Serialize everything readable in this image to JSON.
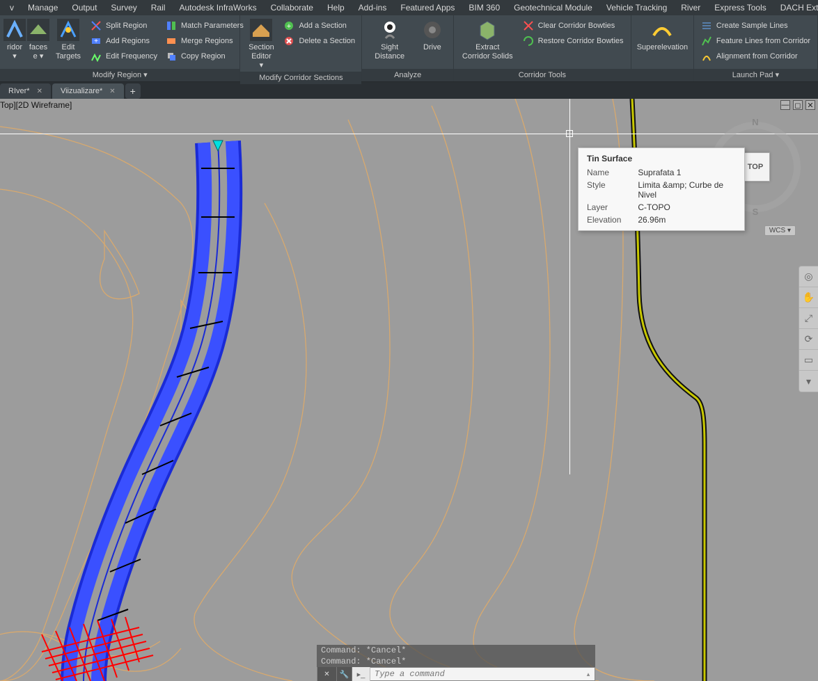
{
  "menubar": {
    "items": [
      "v",
      "Manage",
      "Output",
      "Survey",
      "Rail",
      "Autodesk InfraWorks",
      "Collaborate",
      "Help",
      "Add-ins",
      "Featured Apps",
      "BIM 360",
      "Geotechnical Module",
      "Vehicle Tracking",
      "River",
      "Express Tools",
      "DACH Extension"
    ]
  },
  "ribbon": {
    "panels": [
      {
        "title": "Modify Region ▾",
        "big": [
          {
            "label1": "ridor",
            "label2": "▾",
            "icon": "corridor-icon"
          },
          {
            "label1": "faces",
            "label2": "e ▾",
            "icon": "surface-icon"
          },
          {
            "label1": "Edit",
            "label2": "Targets",
            "icon": "edit-targets-icon"
          }
        ],
        "small": [
          {
            "label": "Split Region",
            "icon": "split-region-icon"
          },
          {
            "label": "Add Regions",
            "icon": "add-regions-icon"
          },
          {
            "label": "Edit Frequency",
            "icon": "edit-frequency-icon"
          }
        ],
        "small2": [
          {
            "label": "Match Parameters",
            "icon": "match-parameters-icon"
          },
          {
            "label": "Merge Regions",
            "icon": "merge-regions-icon"
          },
          {
            "label": "Copy Region",
            "icon": "copy-region-icon"
          }
        ]
      },
      {
        "title": "Modify Corridor Sections",
        "big": [
          {
            "label1": "Section",
            "label2": "Editor ▾",
            "icon": "section-editor-icon"
          }
        ],
        "small": [
          {
            "label": "Add a Section",
            "icon": "add-section-icon"
          },
          {
            "label": "Delete a Section",
            "icon": "delete-section-icon"
          }
        ]
      },
      {
        "title": "Analyze",
        "big": [
          {
            "label1": "Sight Distance",
            "label2": "",
            "icon": "sight-distance-icon"
          },
          {
            "label1": "Drive",
            "label2": "",
            "icon": "drive-icon"
          }
        ]
      },
      {
        "title": "Corridor Tools",
        "big": [
          {
            "label1": "Extract",
            "label2": "Corridor Solids",
            "icon": "extract-solids-icon"
          }
        ],
        "small": [
          {
            "label": "Clear Corridor Bowties",
            "icon": "clear-bowties-icon"
          },
          {
            "label": "Restore Corridor Bowties",
            "icon": "restore-bowties-icon"
          }
        ]
      },
      {
        "title": "",
        "big": [
          {
            "label1": "Superelevation",
            "label2": "",
            "icon": "superelevation-icon"
          }
        ]
      },
      {
        "title": "Launch Pad ▾",
        "small": [
          {
            "label": "Create Sample Lines",
            "icon": "sample-lines-icon"
          },
          {
            "label": "Feature Lines from Corridor",
            "icon": "feature-lines-icon"
          },
          {
            "label": "Alignment from Corridor",
            "icon": "alignment-icon"
          }
        ]
      }
    ]
  },
  "tabs": {
    "items": [
      {
        "label": "RIver*",
        "active": false
      },
      {
        "label": "Viizualizare*",
        "active": true
      }
    ]
  },
  "viewport": {
    "label": "Top][2D Wireframe]",
    "viewcube": "TOP",
    "wcs": "WCS ▾",
    "compass_n": "N",
    "compass_s": "S"
  },
  "tooltip": {
    "title": "Tin Surface",
    "rows": [
      {
        "k": "Name",
        "v": "Suprafata 1"
      },
      {
        "k": "Style",
        "v": "Limita &amp; Curbe de Nivel"
      },
      {
        "k": "Layer",
        "v": "C-TOPO"
      },
      {
        "k": "Elevation",
        "v": "26.96m"
      }
    ]
  },
  "command": {
    "history": [
      "Command: *Cancel*",
      "Command: *Cancel*"
    ],
    "placeholder": "Type a command"
  },
  "colors": {
    "contour": "#d8a96e",
    "corridor": "#3040ff",
    "corridor_edge": "#1a2bd6",
    "daylight": "#ff0000",
    "align_outer": "#111",
    "align_inner": "#c8c800"
  }
}
